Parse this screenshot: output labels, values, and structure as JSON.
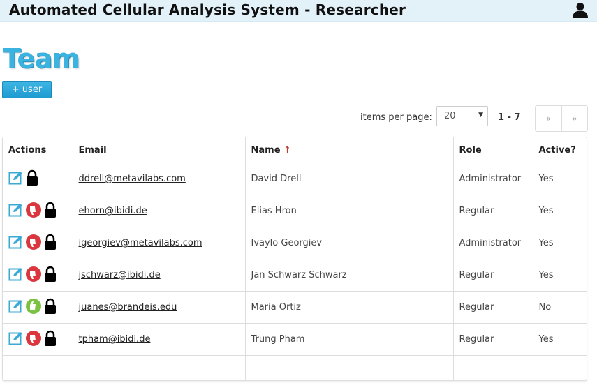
{
  "header": {
    "title": "Automated Cellular Analysis System - Researcher",
    "user_icon": "user-icon"
  },
  "page": {
    "title": "Team",
    "add_user_label": "+ user"
  },
  "pager": {
    "items_label": "items per page:",
    "per_page": "20",
    "range": "1 - 7",
    "prev": "«",
    "next": "»"
  },
  "table": {
    "columns": {
      "actions": "Actions",
      "email": "Email",
      "name": "Name",
      "sort_indicator": "↑",
      "role": "Role",
      "active": "Active?"
    },
    "rows": [
      {
        "email": "ddrell@metavilabs.com",
        "name": "David Drell",
        "role": "Administrator",
        "active": "Yes",
        "toggle": "none"
      },
      {
        "email": "ehorn@ibidi.de",
        "name": "Elias Hron",
        "role": "Regular",
        "active": "Yes",
        "toggle": "thumbs-down"
      },
      {
        "email": "igeorgiev@metavilabs.com",
        "name": "Ivaylo Georgiev",
        "role": "Administrator",
        "active": "Yes",
        "toggle": "thumbs-down"
      },
      {
        "email": "jschwarz@ibidi.de",
        "name": "Jan Schwarz Schwarz",
        "role": "Regular",
        "active": "Yes",
        "toggle": "thumbs-down"
      },
      {
        "email": "juanes@brandeis.edu",
        "name": "Maria Ortiz",
        "role": "Regular",
        "active": "No",
        "toggle": "thumbs-up"
      },
      {
        "email": "tpham@ibidi.de",
        "name": "Trung Pham",
        "role": "Regular",
        "active": "Yes",
        "toggle": "thumbs-down"
      }
    ]
  },
  "colors": {
    "accent": "#3bb3e0",
    "header_bg": "#e3f1f9",
    "deactivate": "#d9363e",
    "activate": "#7cc242"
  }
}
